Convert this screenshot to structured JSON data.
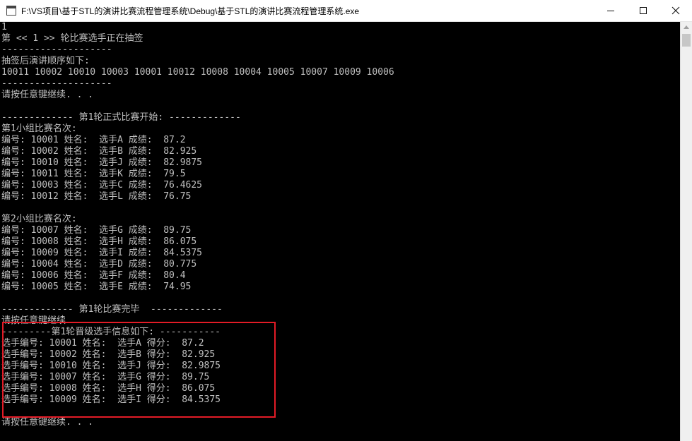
{
  "window": {
    "title": "F:\\VS项目\\基于STL的演讲比赛流程管理系统\\Debug\\基于STL的演讲比赛流程管理系统.exe"
  },
  "titlebar_buttons": {
    "minimize": "minimize-icon",
    "maximize": "maximize-icon",
    "close": "close-icon"
  },
  "console": {
    "lines": [
      "1",
      "第 << 1 >> 轮比赛选手正在抽签",
      "--------------------",
      "抽签后演讲顺序如下:",
      "10011 10002 10010 10003 10001 10012 10008 10004 10005 10007 10009 10006",
      "--------------------",
      "请按任意键继续. . .",
      "",
      "------------- 第1轮正式比赛开始: -------------",
      "第1小组比赛名次:",
      "编号: 10001 姓名:  选手A 成绩:  87.2",
      "编号: 10002 姓名:  选手B 成绩:  82.925",
      "编号: 10010 姓名:  选手J 成绩:  82.9875",
      "编号: 10011 姓名:  选手K 成绩:  79.5",
      "编号: 10003 姓名:  选手C 成绩:  76.4625",
      "编号: 10012 姓名:  选手L 成绩:  76.75",
      "",
      "第2小组比赛名次:",
      "编号: 10007 姓名:  选手G 成绩:  89.75",
      "编号: 10008 姓名:  选手H 成绩:  86.075",
      "编号: 10009 姓名:  选手I 成绩:  84.5375",
      "编号: 10004 姓名:  选手D 成绩:  80.775",
      "编号: 10006 姓名:  选手F 成绩:  80.4",
      "编号: 10005 姓名:  选手E 成绩:  74.95",
      "",
      "------------- 第1轮比赛完毕  -------------",
      "请按任意键继续. . .",
      "---------第1轮晋级选手信息如下: -----------",
      "选手编号: 10001 姓名:  选手A 得分:  87.2",
      "选手编号: 10002 姓名:  选手B 得分:  82.925",
      "选手编号: 10010 姓名:  选手J 得分:  82.9875",
      "选手编号: 10007 姓名:  选手G 得分:  89.75",
      "选手编号: 10008 姓名:  选手H 得分:  86.075",
      "选手编号: 10009 姓名:  选手I 得分:  84.5375",
      "",
      "请按任意键继续. . ."
    ]
  },
  "colors": {
    "console_background": "#000000",
    "console_text": "#c0c0c0",
    "highlight_border": "#e21b26",
    "titlebar_background": "#ffffff"
  }
}
